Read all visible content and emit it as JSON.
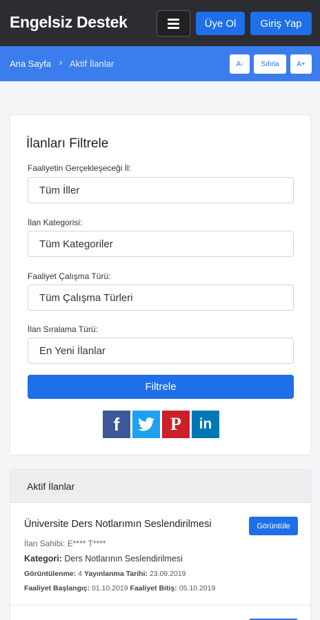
{
  "header": {
    "brand": "Engelsiz Destek",
    "register_label": "Üye Ol",
    "login_label": "Giriş Yap"
  },
  "breadcrumb": {
    "home": "Ana Sayfa",
    "separator": "›",
    "current": "Aktif İlanlar"
  },
  "font_controls": {
    "decrease": "A-",
    "reset": "Sıfırla",
    "increase": "A+"
  },
  "filter": {
    "title": "İlanları Filtrele",
    "fields": [
      {
        "label": "Faaliyetin Gerçekleşeceği İl:",
        "value": "Tüm İller"
      },
      {
        "label": "İlan Kategorisi:",
        "value": "Tüm Kategoriler"
      },
      {
        "label": "Faaliyet Çalışma Türü:",
        "value": "Tüm Çalışma Türleri"
      },
      {
        "label": "İlan Sıralama Türü:",
        "value": "En Yeni İlanlar"
      }
    ],
    "submit_label": "Filtrele"
  },
  "share": {
    "facebook": "f",
    "twitter_icon": "twitter-bird",
    "pinterest": "P",
    "linkedin": "in"
  },
  "listings": {
    "heading": "Aktif İlanlar",
    "items": [
      {
        "title": "Üniversite Ders Notlarımın Seslendirilmesi",
        "view_label": "Görüntüle",
        "owner_label": "İlan Sahibi:",
        "owner": "E**** T****",
        "category_label": "Kategori:",
        "category": "Ders Notlarının Seslendirilmesi",
        "views_label": "Görüntülenme:",
        "views": "4",
        "published_label": "Yayınlanma Tarihi:",
        "published": "23.09.2019",
        "start_label": "Faaliyet Başlangıç:",
        "start": "01.10.2019",
        "end_label": "Faaliyet Bitiş:",
        "end": "05.10.2019"
      }
    ]
  },
  "colors": {
    "navbar": "#2b2d30",
    "breadcrumb_bar": "#3b7ded",
    "primary": "#1e6fe8",
    "facebook": "#3b5998",
    "twitter": "#1da1f2",
    "pinterest": "#cb2027",
    "linkedin": "#0077b5"
  }
}
